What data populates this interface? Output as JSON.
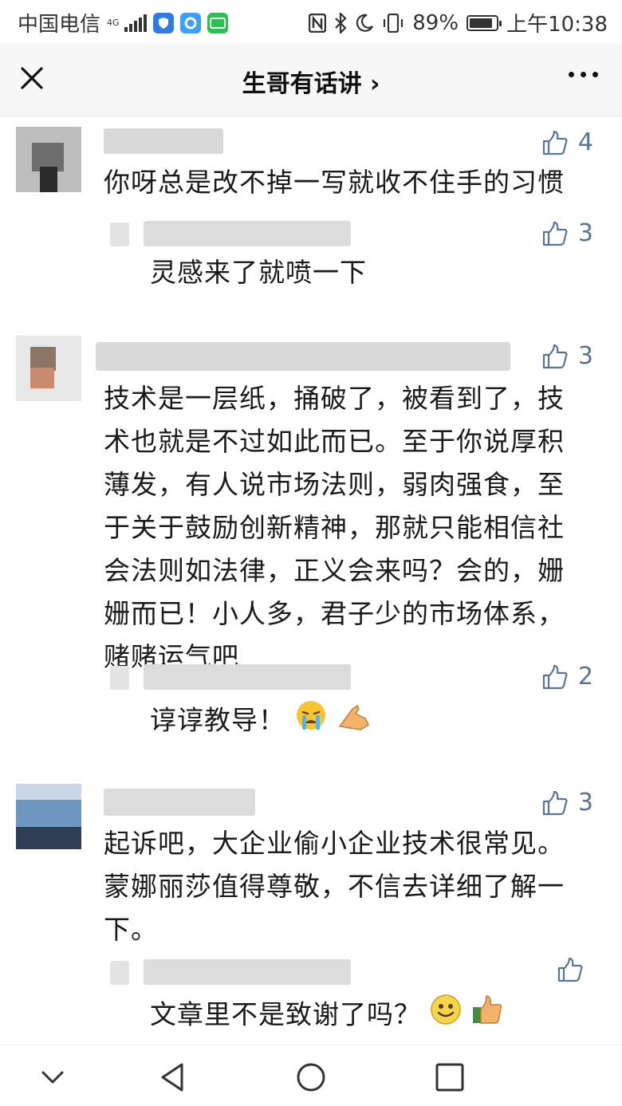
{
  "status_bar": {
    "carrier": "中国电信",
    "network": "4G",
    "battery": "89%",
    "battery_level": 0.89,
    "time": "上午10:38",
    "icons": [
      "signal-icon",
      "shield-app-icon",
      "browser-app-icon",
      "iqiyi-app-icon",
      "nfc-icon",
      "bluetooth-icon",
      "moon-icon",
      "vibrate-icon",
      "battery-icon"
    ]
  },
  "header": {
    "title": "生哥有话讲 ›",
    "icons": [
      "close-icon",
      "more-icon"
    ]
  },
  "comments": [
    {
      "likes": "4",
      "text": "你呀总是改不掉一写就收不住手的习惯",
      "reply": {
        "likes": "3",
        "text": "灵感来了就喷一下"
      }
    },
    {
      "likes": "3",
      "text_lines": [
        "技术是一层纸，捅破了，被看到了，技",
        "术也就是不过如此而已。至于你说厚积",
        "薄发，有人说市场法则，弱肉强食，至",
        "于关于鼓励创新精神，那就只能相信社",
        "会法则如法律，正义会来吗？会的，姗",
        "姗而已！小人多，君子少的市场体系，",
        "赌赌运气吧"
      ],
      "reply": {
        "likes": "2",
        "text": "谆谆教导！",
        "emojis": [
          "crying-emoji",
          "hand-emoji"
        ]
      }
    },
    {
      "likes": "3",
      "text_lines": [
        "起诉吧，大企业偷小企业技术很常见。",
        "蒙娜丽莎值得尊敬，不信去详细了解一",
        "下。"
      ],
      "reply": {
        "likes": "",
        "text": "文章里不是致谢了吗？",
        "emojis": [
          "smile-emoji",
          "thumbs-up-emoji"
        ]
      }
    }
  ],
  "nav_bar": {
    "icons": [
      "chevron-down-icon",
      "back-icon",
      "home-icon",
      "recents-icon"
    ]
  },
  "colors": {
    "like_blue": "#57749c",
    "text": "#1a1a1a",
    "header_bg": "#f7f7f7"
  }
}
